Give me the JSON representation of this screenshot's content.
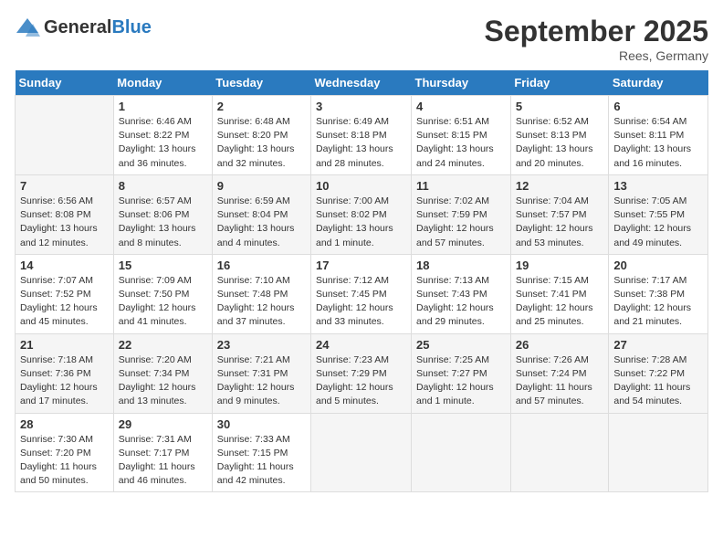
{
  "logo": {
    "general": "General",
    "blue": "Blue"
  },
  "title": "September 2025",
  "location": "Rees, Germany",
  "weekdays": [
    "Sunday",
    "Monday",
    "Tuesday",
    "Wednesday",
    "Thursday",
    "Friday",
    "Saturday"
  ],
  "weeks": [
    [
      {
        "day": "",
        "info": ""
      },
      {
        "day": "1",
        "info": "Sunrise: 6:46 AM\nSunset: 8:22 PM\nDaylight: 13 hours\nand 36 minutes."
      },
      {
        "day": "2",
        "info": "Sunrise: 6:48 AM\nSunset: 8:20 PM\nDaylight: 13 hours\nand 32 minutes."
      },
      {
        "day": "3",
        "info": "Sunrise: 6:49 AM\nSunset: 8:18 PM\nDaylight: 13 hours\nand 28 minutes."
      },
      {
        "day": "4",
        "info": "Sunrise: 6:51 AM\nSunset: 8:15 PM\nDaylight: 13 hours\nand 24 minutes."
      },
      {
        "day": "5",
        "info": "Sunrise: 6:52 AM\nSunset: 8:13 PM\nDaylight: 13 hours\nand 20 minutes."
      },
      {
        "day": "6",
        "info": "Sunrise: 6:54 AM\nSunset: 8:11 PM\nDaylight: 13 hours\nand 16 minutes."
      }
    ],
    [
      {
        "day": "7",
        "info": "Sunrise: 6:56 AM\nSunset: 8:08 PM\nDaylight: 13 hours\nand 12 minutes."
      },
      {
        "day": "8",
        "info": "Sunrise: 6:57 AM\nSunset: 8:06 PM\nDaylight: 13 hours\nand 8 minutes."
      },
      {
        "day": "9",
        "info": "Sunrise: 6:59 AM\nSunset: 8:04 PM\nDaylight: 13 hours\nand 4 minutes."
      },
      {
        "day": "10",
        "info": "Sunrise: 7:00 AM\nSunset: 8:02 PM\nDaylight: 13 hours\nand 1 minute."
      },
      {
        "day": "11",
        "info": "Sunrise: 7:02 AM\nSunset: 7:59 PM\nDaylight: 12 hours\nand 57 minutes."
      },
      {
        "day": "12",
        "info": "Sunrise: 7:04 AM\nSunset: 7:57 PM\nDaylight: 12 hours\nand 53 minutes."
      },
      {
        "day": "13",
        "info": "Sunrise: 7:05 AM\nSunset: 7:55 PM\nDaylight: 12 hours\nand 49 minutes."
      }
    ],
    [
      {
        "day": "14",
        "info": "Sunrise: 7:07 AM\nSunset: 7:52 PM\nDaylight: 12 hours\nand 45 minutes."
      },
      {
        "day": "15",
        "info": "Sunrise: 7:09 AM\nSunset: 7:50 PM\nDaylight: 12 hours\nand 41 minutes."
      },
      {
        "day": "16",
        "info": "Sunrise: 7:10 AM\nSunset: 7:48 PM\nDaylight: 12 hours\nand 37 minutes."
      },
      {
        "day": "17",
        "info": "Sunrise: 7:12 AM\nSunset: 7:45 PM\nDaylight: 12 hours\nand 33 minutes."
      },
      {
        "day": "18",
        "info": "Sunrise: 7:13 AM\nSunset: 7:43 PM\nDaylight: 12 hours\nand 29 minutes."
      },
      {
        "day": "19",
        "info": "Sunrise: 7:15 AM\nSunset: 7:41 PM\nDaylight: 12 hours\nand 25 minutes."
      },
      {
        "day": "20",
        "info": "Sunrise: 7:17 AM\nSunset: 7:38 PM\nDaylight: 12 hours\nand 21 minutes."
      }
    ],
    [
      {
        "day": "21",
        "info": "Sunrise: 7:18 AM\nSunset: 7:36 PM\nDaylight: 12 hours\nand 17 minutes."
      },
      {
        "day": "22",
        "info": "Sunrise: 7:20 AM\nSunset: 7:34 PM\nDaylight: 12 hours\nand 13 minutes."
      },
      {
        "day": "23",
        "info": "Sunrise: 7:21 AM\nSunset: 7:31 PM\nDaylight: 12 hours\nand 9 minutes."
      },
      {
        "day": "24",
        "info": "Sunrise: 7:23 AM\nSunset: 7:29 PM\nDaylight: 12 hours\nand 5 minutes."
      },
      {
        "day": "25",
        "info": "Sunrise: 7:25 AM\nSunset: 7:27 PM\nDaylight: 12 hours\nand 1 minute."
      },
      {
        "day": "26",
        "info": "Sunrise: 7:26 AM\nSunset: 7:24 PM\nDaylight: 11 hours\nand 57 minutes."
      },
      {
        "day": "27",
        "info": "Sunrise: 7:28 AM\nSunset: 7:22 PM\nDaylight: 11 hours\nand 54 minutes."
      }
    ],
    [
      {
        "day": "28",
        "info": "Sunrise: 7:30 AM\nSunset: 7:20 PM\nDaylight: 11 hours\nand 50 minutes."
      },
      {
        "day": "29",
        "info": "Sunrise: 7:31 AM\nSunset: 7:17 PM\nDaylight: 11 hours\nand 46 minutes."
      },
      {
        "day": "30",
        "info": "Sunrise: 7:33 AM\nSunset: 7:15 PM\nDaylight: 11 hours\nand 42 minutes."
      },
      {
        "day": "",
        "info": ""
      },
      {
        "day": "",
        "info": ""
      },
      {
        "day": "",
        "info": ""
      },
      {
        "day": "",
        "info": ""
      }
    ]
  ]
}
